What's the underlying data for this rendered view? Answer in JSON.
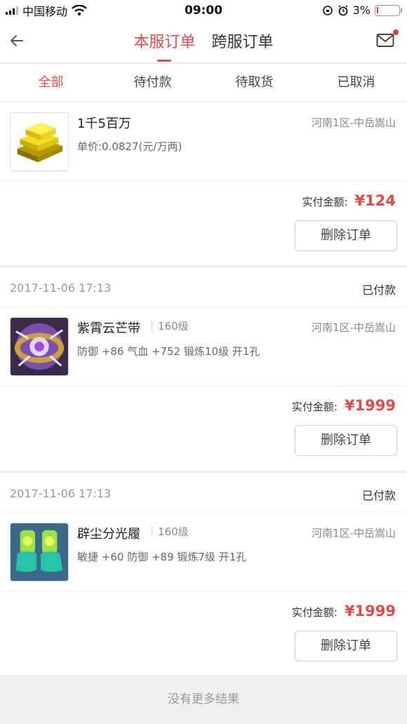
{
  "status_bar": {
    "carrier": "中国移动",
    "time": "09:00",
    "battery": "3%"
  },
  "nav": {
    "tabs": [
      "本服订单",
      "跨服订单"
    ],
    "active_tab": 0
  },
  "filters": [
    "全部",
    "待付款",
    "待取货",
    "已取消"
  ],
  "orders": [
    {
      "date": "",
      "status": "",
      "icon": "gold-bars-icon",
      "name": "1千5百万",
      "level": "",
      "server": "河南1区-中岳嵩山",
      "attrs": "单价:0.0827(元/万两)",
      "paid_label": "实付金额:",
      "amount": "¥124",
      "delete_label": "删除订单"
    },
    {
      "date": "2017-11-06 17:13",
      "status": "已付款",
      "icon": "belt-icon",
      "name": "紫霄云芒带",
      "level": "160级",
      "server": "河南1区-中岳嵩山",
      "attrs": "防御 +86 气血 +752 锻炼10级 开1孔",
      "paid_label": "实付金额:",
      "amount": "¥1999",
      "delete_label": "删除订单"
    },
    {
      "date": "2017-11-06 17:13",
      "status": "已付款",
      "icon": "boots-icon",
      "name": "辟尘分光履",
      "level": "160级",
      "server": "河南1区-中岳嵩山",
      "attrs": "敏捷 +60 防御 +89 锻炼7级 开1孔",
      "paid_label": "实付金额:",
      "amount": "¥1999",
      "delete_label": "删除订单"
    }
  ],
  "footer": {
    "no_more": "没有更多结果"
  },
  "colors": {
    "accent": "#e04a4a",
    "muted": "#999999"
  }
}
